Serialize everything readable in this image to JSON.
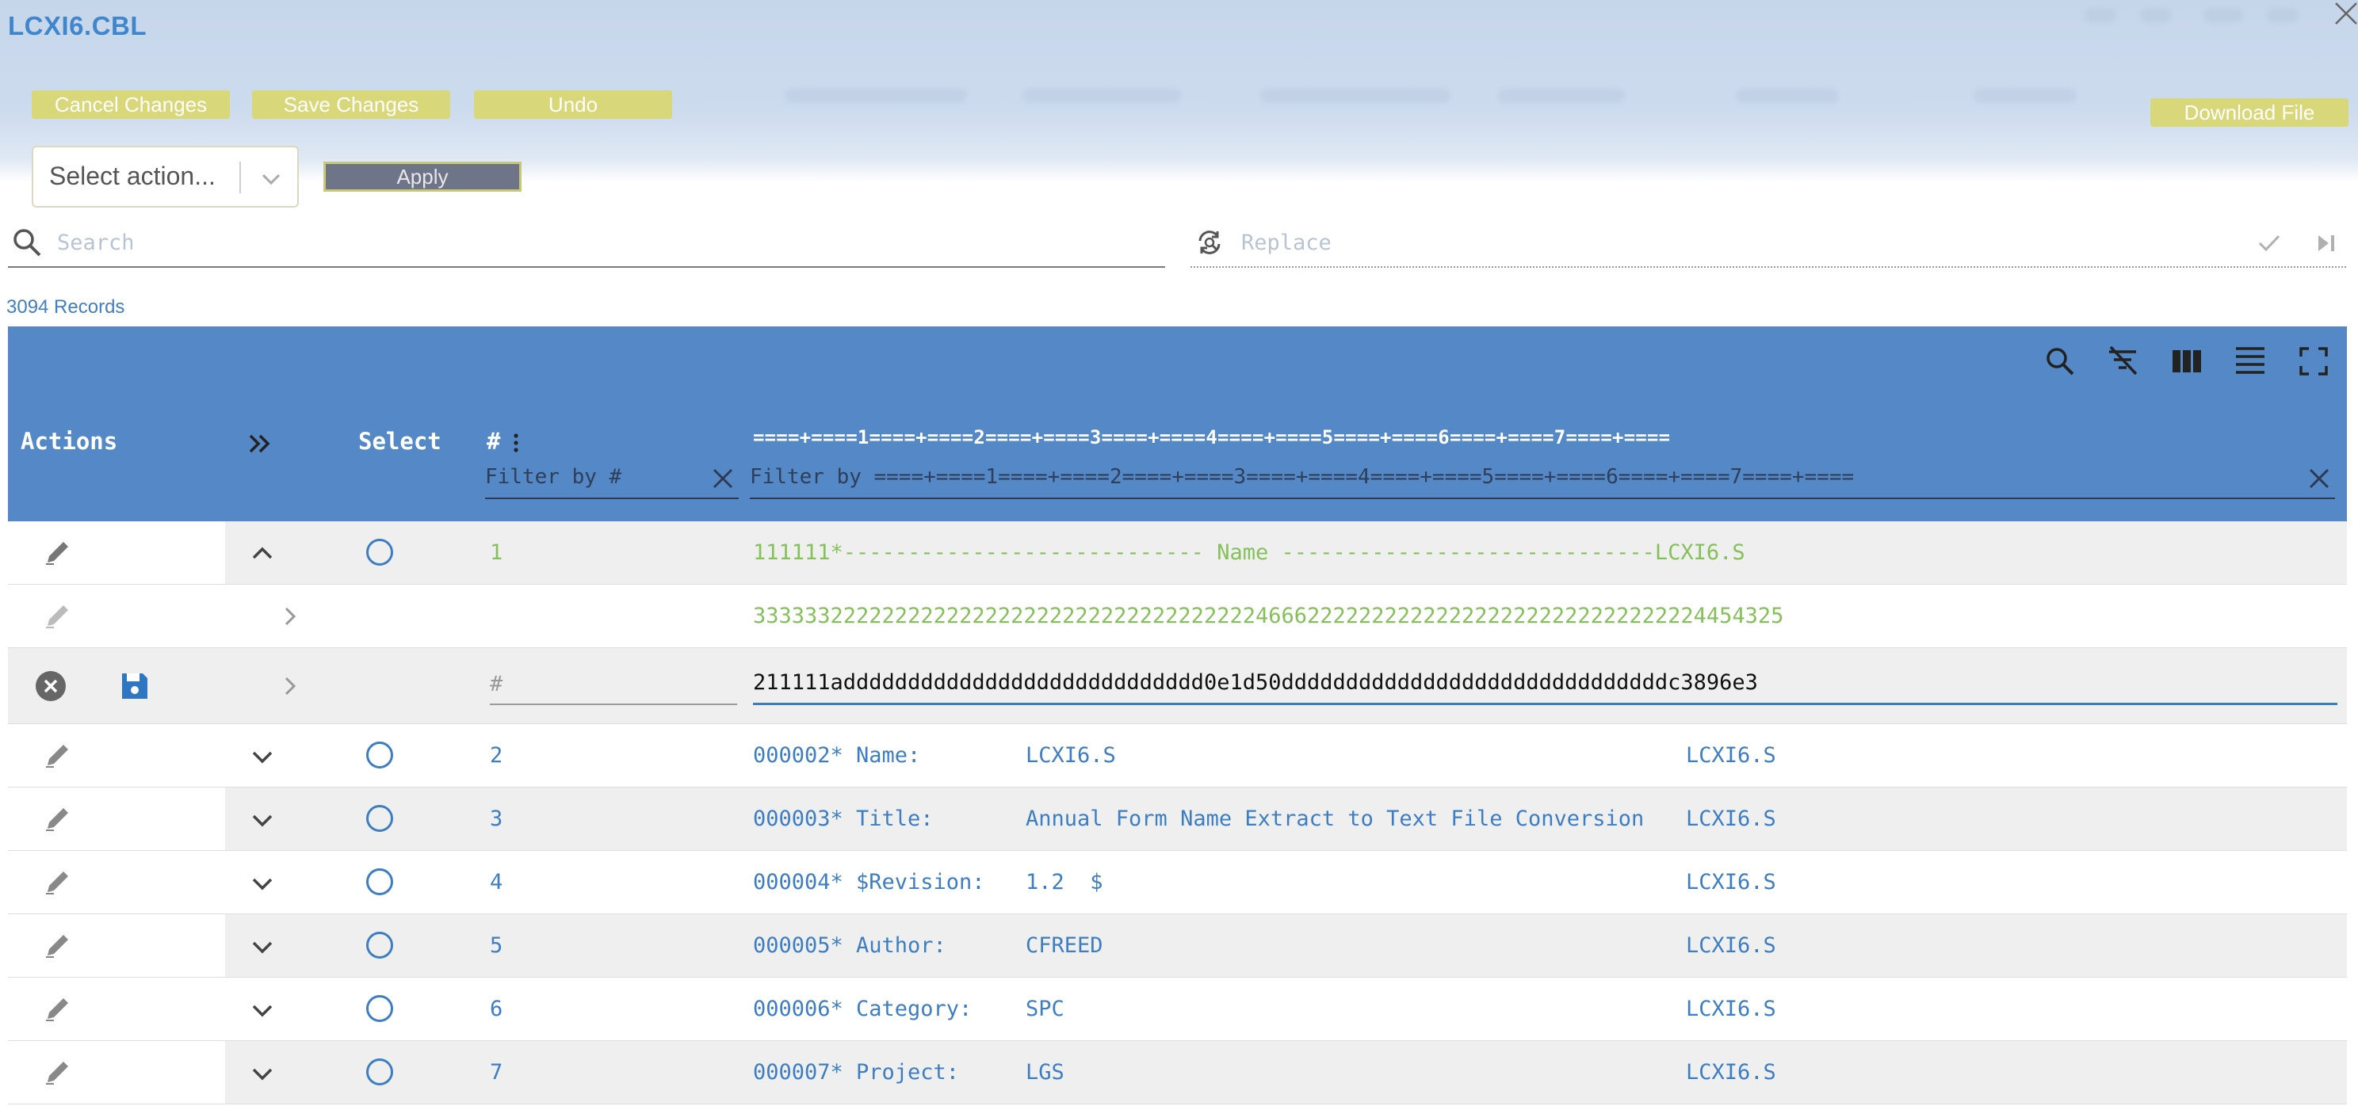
{
  "modal": {
    "title": "LCXI6.CBL"
  },
  "toolbar": {
    "cancel_label": "Cancel Changes",
    "save_label": "Save Changes",
    "undo_label": "Undo",
    "download_label": "Download File",
    "action_select_value": "Select action...",
    "apply_label": "Apply"
  },
  "search": {
    "placeholder": "Search"
  },
  "replace": {
    "placeholder": "Replace"
  },
  "records_count": "3094 Records",
  "grid": {
    "headers": {
      "actions": "Actions",
      "select": "Select",
      "number": "#",
      "ruler": "====+====1====+====2====+====3====+====4====+====5====+====6====+====7====+===="
    },
    "filters": {
      "number_placeholder": "Filter by #",
      "record_placeholder": "Filter by ====+====1====+====2====+====3====+====4====+====5====+====6====+====7====+===="
    },
    "hex_rows": {
      "num": "1",
      "text": "111111*---------------------------- Name -----------------------------LCXI6.S",
      "zone": "33333322222222222222222222222222222222246662222222222222222222222222222224454325",
      "digit_value": "211111adddddddddddddddddddddddddddd0e1d50ddddddddddddddddddddddddddddddc3896e3",
      "digit_placeholder": "#"
    },
    "rows": [
      {
        "num": "2",
        "seq": "000002*",
        "label": "Name:",
        "value": "LCXI6.S",
        "tag": "LCXI6.S"
      },
      {
        "num": "3",
        "seq": "000003*",
        "label": "Title:",
        "value": "Annual Form Name Extract to Text File Conversion",
        "tag": "LCXI6.S"
      },
      {
        "num": "4",
        "seq": "000004*",
        "label": "$Revision:",
        "value": "1.2  $",
        "tag": "LCXI6.S"
      },
      {
        "num": "5",
        "seq": "000005*",
        "label": "Author:",
        "value": "CFREED",
        "tag": "LCXI6.S"
      },
      {
        "num": "6",
        "seq": "000006*",
        "label": "Category:",
        "value": "SPC",
        "tag": "LCXI6.S"
      },
      {
        "num": "7",
        "seq": "000007*",
        "label": "Project:",
        "value": "LGS",
        "tag": "LCXI6.S"
      }
    ]
  },
  "colors": {
    "accent": "#5488c6",
    "yellow_button": "#d8d87a",
    "link_blue": "#3d7dc3",
    "record_green": "#86c05a"
  }
}
